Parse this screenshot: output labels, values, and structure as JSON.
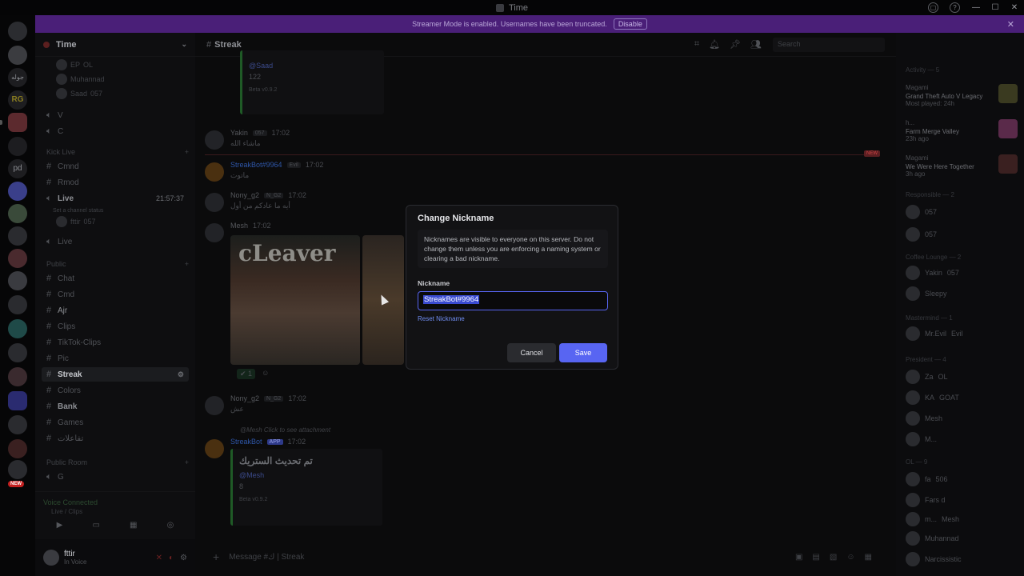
{
  "window": {
    "title": "Time"
  },
  "banner": {
    "text": "Streamer Mode is enabled. Usernames have been truncated.",
    "disable_label": "Disable"
  },
  "server": {
    "name": "Time"
  },
  "sidebar": {
    "voice_users_top": [
      {
        "name": "EP",
        "tag": "OL"
      },
      {
        "name": "Muhannad",
        "tag": ""
      },
      {
        "name": "Saad",
        "tag": "057"
      }
    ],
    "channels_a": [
      "V",
      "C"
    ],
    "category_kick": "Kick Live",
    "channels_kick": [
      "Cmnd",
      "Rmod",
      "Live"
    ],
    "live_status": "Set a channel status",
    "live_timer": "21:57:37",
    "live_user": {
      "name": "fttir",
      "tag": "057"
    },
    "channel_live2": "Live",
    "category_public": "Public",
    "channels_public": [
      "Chat",
      "Cmd",
      "Ajr",
      "Clips",
      "TikTok-Clips",
      "Pic",
      "Streak",
      "Colors",
      "Bank",
      "Games",
      "تفاعلات"
    ],
    "category_room": "Public Room",
    "channels_room": [
      "G"
    ]
  },
  "voice_panel": {
    "status": "Voice Connected",
    "channel": "Live / Clips"
  },
  "user_panel": {
    "name": "fttir",
    "status": "In Voice"
  },
  "chat": {
    "channel_name": "Streak",
    "search_placeholder": "Search",
    "messages": [
      {
        "author": "Saad",
        "embed_value": "122",
        "beta": "Beta v0.9.2"
      },
      {
        "author": "Yakin",
        "tag": "057",
        "time": "17:02",
        "text": "ماشاء الله"
      },
      {
        "author": "StreakBot#9964",
        "tag": "Evil",
        "time": "17:02",
        "text": "ماتوت"
      },
      {
        "author": "Nony_g2",
        "tag": "N_G2",
        "time": "17:02",
        "text": "أيه ما عادكم من أول"
      },
      {
        "author": "Mesh",
        "time": "17:02"
      },
      {
        "author": "Nony_g2",
        "tag": "N_G2",
        "time": "17:02",
        "text": "عش"
      },
      {
        "reply": "@Mesh Click to see attachment"
      },
      {
        "author": "StreakBot",
        "tag": "APP",
        "time": "17:02",
        "embed_title": "تم تحديث الستريك",
        "mention": "@Mesh",
        "embed_value": "8",
        "beta": "Beta v0.9.2"
      }
    ],
    "img_text": "cLeaver",
    "reaction_count": "1",
    "new_label": "NEW",
    "composer_placeholder": "Message #ك | Streak"
  },
  "members": {
    "activity_title": "Activity — 5",
    "activities": [
      {
        "user": "Magami",
        "game": "Grand Theft Auto V Legacy",
        "sub": "Most played: 24h"
      },
      {
        "user": "h...",
        "game": "Farm Merge Valley",
        "sub": "23h ago"
      },
      {
        "user": "Magami",
        "game": "We Were Here Together",
        "sub": "3h ago"
      }
    ],
    "groups": [
      {
        "title": "Responsible — 2",
        "members": [
          {
            "name": "",
            "tag": "057"
          },
          {
            "name": "",
            "tag": "057"
          }
        ]
      },
      {
        "title": "Coffee Lounge — 2",
        "members": [
          {
            "name": "Yakin",
            "tag": "057"
          },
          {
            "name": "Sleepy",
            "tag": ""
          }
        ]
      },
      {
        "title": "Mastermind — 1",
        "members": [
          {
            "name": "Mr.Evil",
            "tag": "Evil"
          }
        ]
      },
      {
        "title": "President — 4",
        "members": [
          {
            "name": "Za",
            "tag": "OL"
          },
          {
            "name": "KA",
            "tag": "GOAT"
          },
          {
            "name": "Mesh",
            "tag": ""
          },
          {
            "name": "M...",
            "tag": ""
          }
        ]
      },
      {
        "title": "OL — 9",
        "members": [
          {
            "name": "fa",
            "tag": "506"
          },
          {
            "name": "Fars d",
            "tag": ""
          },
          {
            "name": "m...",
            "tag": "Mesh"
          },
          {
            "name": "Muhannad",
            "tag": ""
          },
          {
            "name": "Narcissistic",
            "tag": ""
          }
        ]
      }
    ]
  },
  "modal": {
    "title": "Change Nickname",
    "note": "Nicknames are visible to everyone on this server. Do not change them unless you are enforcing a naming system or clearing a bad nickname.",
    "label": "Nickname",
    "value": "StreakBot#9964",
    "reset_label": "Reset Nickname",
    "cancel_label": "Cancel",
    "save_label": "Save"
  },
  "guild_badge": "NEW",
  "colors": {
    "accent": "#5865f2",
    "banner": "#4a1f78",
    "link": "#6f8cf0"
  }
}
